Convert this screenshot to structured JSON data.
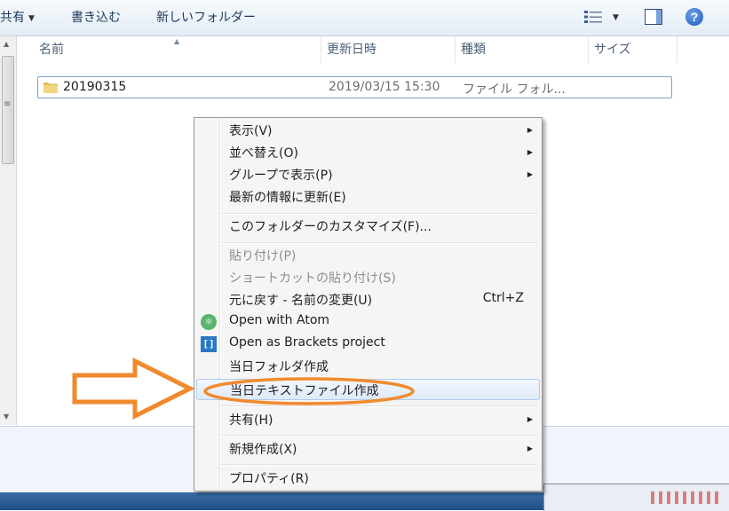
{
  "toolbar": {
    "share_label": "共有",
    "burn_label": "書き込む",
    "new_folder_label": "新しいフォルダー",
    "help_label": "?"
  },
  "columns": {
    "name": "名前",
    "date": "更新日時",
    "type": "種類",
    "size": "サイズ"
  },
  "files": [
    {
      "name": "20190315",
      "date": "2019/03/15 15:30",
      "type": "ファイル フォル..."
    }
  ],
  "context_menu": {
    "items": {
      "view": "表示(V)",
      "sort": "並べ替え(O)",
      "group": "グループで表示(P)",
      "refresh": "最新の情報に更新(E)",
      "customize": "このフォルダーのカスタマイズ(F)...",
      "paste": "貼り付け(P)",
      "paste_shortcut": "ショートカットの貼り付け(S)",
      "undo": "元に戻す - 名前の変更(U)",
      "undo_shortcut": "Ctrl+Z",
      "open_atom": "Open with Atom",
      "open_brackets": "Open as Brackets project",
      "today_folder": "当日フォルダ作成",
      "today_text": "当日テキストファイル作成",
      "share": "共有(H)",
      "new": "新規作成(X)",
      "properties": "プロパティ(R)"
    }
  },
  "colors": {
    "annotation": "#f08a2c",
    "accent": "#1c58b8"
  },
  "icons": {
    "folder": "folder-icon",
    "atom": "atom-icon",
    "brackets": "brackets-icon",
    "submenu": "chevron-right-icon"
  }
}
